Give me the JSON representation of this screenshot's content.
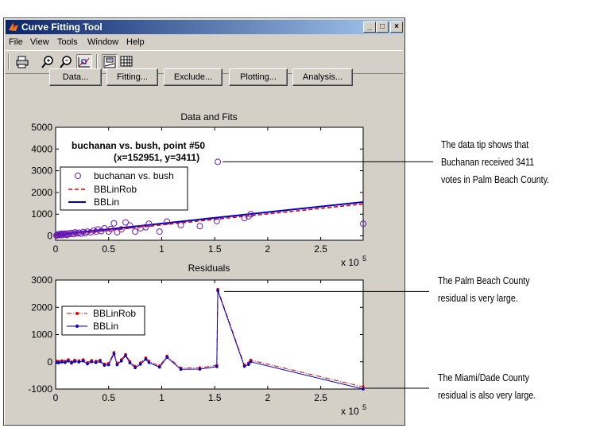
{
  "window": {
    "title": "Curve Fitting Tool",
    "controls": {
      "minimize": "_",
      "maximize": "□",
      "close": "×"
    }
  },
  "menu": [
    "File",
    "View",
    "Tools",
    "Window",
    "Help"
  ],
  "toolbar": {
    "icons": [
      "print-icon",
      "zoom-in-icon",
      "zoom-out-icon",
      "data-cursor-icon",
      "legend-icon",
      "grid-icon"
    ]
  },
  "buttons": {
    "data": "Data...",
    "fitting": "Fitting...",
    "exclude": "Exclude...",
    "plotting": "Plotting...",
    "analysis": "Analysis..."
  },
  "chart_data": [
    {
      "type": "scatter",
      "title": "Data and Fits",
      "xlabel": "",
      "ylabel": "",
      "xlim": [
        0,
        290000
      ],
      "ylim": [
        -200,
        5000
      ],
      "x_ticks": [
        0,
        0.5,
        1,
        1.5,
        2,
        2.5
      ],
      "x_exponent": "x 10",
      "x_exponent_power": "5",
      "y_ticks": [
        0,
        1000,
        2000,
        3000,
        4000,
        5000
      ],
      "datatip": {
        "line1": "buchanan vs. bush, point #50",
        "line2": "(x=152951, y=3411)",
        "x": 152951,
        "y": 3411
      },
      "series": [
        {
          "name": "buchanan vs. bush",
          "style": "marker-circle",
          "color": "#6a1bb5",
          "points": [
            [
              800,
              20
            ],
            [
              1500,
              50
            ],
            [
              2000,
              30
            ],
            [
              3000,
              80
            ],
            [
              3500,
              40
            ],
            [
              4500,
              60
            ],
            [
              5500,
              100
            ],
            [
              6000,
              30
            ],
            [
              7000,
              90
            ],
            [
              8000,
              60
            ],
            [
              9000,
              110
            ],
            [
              10000,
              70
            ],
            [
              11000,
              40
            ],
            [
              12500,
              120
            ],
            [
              14000,
              90
            ],
            [
              15500,
              140
            ],
            [
              17000,
              80
            ],
            [
              18500,
              160
            ],
            [
              20000,
              110
            ],
            [
              22000,
              150
            ],
            [
              24000,
              100
            ],
            [
              26000,
              180
            ],
            [
              28000,
              130
            ],
            [
              30000,
              200
            ],
            [
              33000,
              160
            ],
            [
              36000,
              250
            ],
            [
              38000,
              190
            ],
            [
              40000,
              300
            ],
            [
              43000,
              220
            ],
            [
              46000,
              350
            ],
            [
              50000,
              200
            ],
            [
              52000,
              320
            ],
            [
              55000,
              580
            ],
            [
              58000,
              170
            ],
            [
              62000,
              300
            ],
            [
              66000,
              620
            ],
            [
              70000,
              480
            ],
            [
              75000,
              200
            ],
            [
              80000,
              350
            ],
            [
              85000,
              400
            ],
            [
              88000,
              560
            ],
            [
              98000,
              200
            ],
            [
              105000,
              660
            ],
            [
              118000,
              500
            ],
            [
              136000,
              450
            ],
            [
              152951,
              3411
            ],
            [
              152000,
              680
            ],
            [
              178000,
              820
            ],
            [
              182000,
              900
            ],
            [
              184000,
              1000
            ],
            [
              290000,
              560
            ]
          ]
        },
        {
          "name": "BBLinRob",
          "style": "dashed",
          "color": "#e00000",
          "line": [
            [
              0,
              0
            ],
            [
              290000,
              1470
            ]
          ]
        },
        {
          "name": "BBLin",
          "style": "solid",
          "color": "#0000c8",
          "line": [
            [
              0,
              50
            ],
            [
              290000,
              1560
            ]
          ]
        }
      ]
    },
    {
      "type": "line",
      "title": "Residuals",
      "xlabel": "",
      "ylabel": "",
      "xlim": [
        0,
        290000
      ],
      "ylim": [
        -1000,
        3000
      ],
      "x_ticks": [
        0,
        0.5,
        1,
        1.5,
        2,
        2.5
      ],
      "x_exponent": "x 10",
      "x_exponent_power": "5",
      "y_ticks": [
        -1000,
        0,
        1000,
        2000,
        3000
      ],
      "series": [
        {
          "name": "BBLinRob",
          "style": "dash-dot-marker",
          "color": "#e00000",
          "points": [
            [
              1000,
              20
            ],
            [
              3000,
              10
            ],
            [
              6000,
              40
            ],
            [
              9000,
              20
            ],
            [
              12000,
              80
            ],
            [
              15000,
              0
            ],
            [
              18000,
              60
            ],
            [
              22000,
              40
            ],
            [
              26000,
              80
            ],
            [
              30000,
              -30
            ],
            [
              34000,
              50
            ],
            [
              38000,
              20
            ],
            [
              42000,
              60
            ],
            [
              46000,
              -80
            ],
            [
              50000,
              -60
            ],
            [
              55000,
              340
            ],
            [
              58000,
              -60
            ],
            [
              62000,
              80
            ],
            [
              66000,
              270
            ],
            [
              70000,
              10
            ],
            [
              75000,
              -170
            ],
            [
              80000,
              -40
            ],
            [
              85000,
              140
            ],
            [
              88000,
              20
            ],
            [
              98000,
              -150
            ],
            [
              105000,
              210
            ],
            [
              118000,
              -230
            ],
            [
              136000,
              -220
            ],
            [
              152951,
              2660
            ],
            [
              152000,
              -130
            ],
            [
              178000,
              -120
            ],
            [
              182000,
              -40
            ],
            [
              184000,
              60
            ],
            [
              290000,
              -920
            ]
          ]
        },
        {
          "name": "BBLin",
          "style": "solid-marker",
          "color": "#0000c8",
          "points": [
            [
              1000,
              -30
            ],
            [
              3000,
              -40
            ],
            [
              6000,
              -10
            ],
            [
              9000,
              -30
            ],
            [
              12000,
              30
            ],
            [
              15000,
              -50
            ],
            [
              18000,
              10
            ],
            [
              22000,
              -10
            ],
            [
              26000,
              30
            ],
            [
              30000,
              -80
            ],
            [
              34000,
              0
            ],
            [
              38000,
              -30
            ],
            [
              42000,
              10
            ],
            [
              46000,
              -130
            ],
            [
              50000,
              -110
            ],
            [
              55000,
              290
            ],
            [
              58000,
              -110
            ],
            [
              62000,
              30
            ],
            [
              66000,
              220
            ],
            [
              70000,
              -40
            ],
            [
              75000,
              -220
            ],
            [
              80000,
              -90
            ],
            [
              85000,
              90
            ],
            [
              88000,
              -30
            ],
            [
              98000,
              -200
            ],
            [
              105000,
              160
            ],
            [
              118000,
              -280
            ],
            [
              136000,
              -270
            ],
            [
              152951,
              2610
            ],
            [
              152000,
              -180
            ],
            [
              178000,
              -170
            ],
            [
              182000,
              -100
            ],
            [
              184000,
              0
            ],
            [
              290000,
              -1000
            ]
          ]
        }
      ]
    }
  ],
  "annotations": {
    "note1": [
      "The data tip shows that",
      "Buchanan received 3411",
      "votes in Palm Beach County."
    ],
    "note2": [
      "The Palm Beach County",
      "residual is very large."
    ],
    "note3": [
      "The Miami/Dade County",
      "residual is also very large."
    ]
  }
}
